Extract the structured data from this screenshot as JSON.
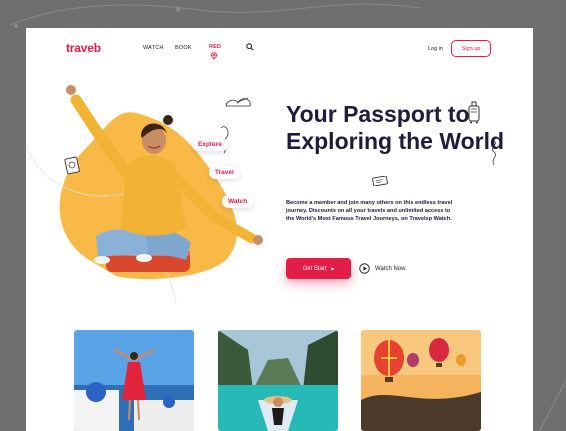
{
  "brand": {
    "logo": "traveb",
    "accent": "#e11d48",
    "text_dark": "#1f1b3a",
    "hero_blob": "#f9b946"
  },
  "nav": {
    "watch": "WATCH",
    "book": "BOOK",
    "red": "RED",
    "login": "Log in",
    "signup": "Sign up"
  },
  "hero": {
    "tags": [
      "Explore",
      "Travel",
      "Watch"
    ],
    "title": "Your Passport to Exploring the World",
    "description": "Become a member and join many others on this endless travel journey. Discounts on all your travels and unlimited access to the World's Most Famous Travel Journeys, on Travelxp Watch.",
    "cta_primary": "Get Start",
    "cta_secondary": "Watch Now"
  },
  "icons": [
    "red-gem-icon",
    "search-icon",
    "luggage-icon",
    "ticket-icon",
    "play-icon",
    "passport-icon",
    "cloud-icon"
  ],
  "photos": [
    {
      "subject": "santorini-woman-red-dress"
    },
    {
      "subject": "lagoon-boat-hat"
    },
    {
      "subject": "hot-air-balloons"
    }
  ]
}
